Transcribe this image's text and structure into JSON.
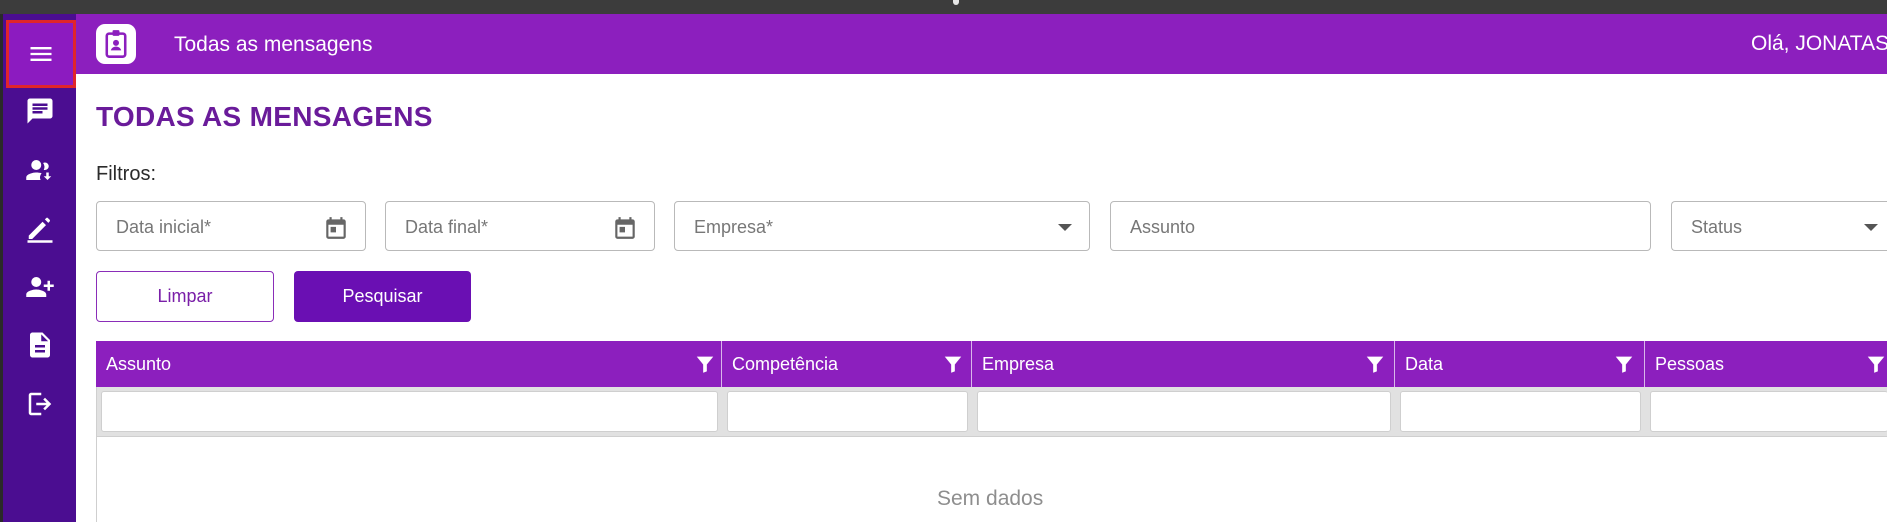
{
  "header": {
    "title": "Todas as mensagens",
    "greeting": "Olá, JONATAS"
  },
  "sidebar": {
    "menu_icon": "menu-icon",
    "items": [
      {
        "name": "messages",
        "icon": "chat-icon"
      },
      {
        "name": "contacts",
        "icon": "users-download-icon"
      },
      {
        "name": "edit",
        "icon": "pencil-icon"
      },
      {
        "name": "add-user",
        "icon": "add-user-icon"
      },
      {
        "name": "documents",
        "icon": "document-icon"
      },
      {
        "name": "logout",
        "icon": "logout-icon"
      }
    ]
  },
  "page": {
    "title": "TODAS AS MENSAGENS",
    "filters_label": "Filtros:"
  },
  "filters": {
    "start_date_placeholder": "Data inicial*",
    "end_date_placeholder": "Data final*",
    "company_placeholder": "Empresa*",
    "subject_placeholder": "Assunto",
    "status_placeholder": "Status"
  },
  "buttons": {
    "clear": "Limpar",
    "search": "Pesquisar"
  },
  "grid": {
    "columns": [
      "Assunto",
      "Competência",
      "Empresa",
      "Data",
      "Pessoas"
    ],
    "empty_text": "Sem dados"
  },
  "colors": {
    "header": "#8c1fbe",
    "sidebar": "#4b0d91",
    "primary_button": "#6a0fb3",
    "title": "#6a1b9a"
  }
}
